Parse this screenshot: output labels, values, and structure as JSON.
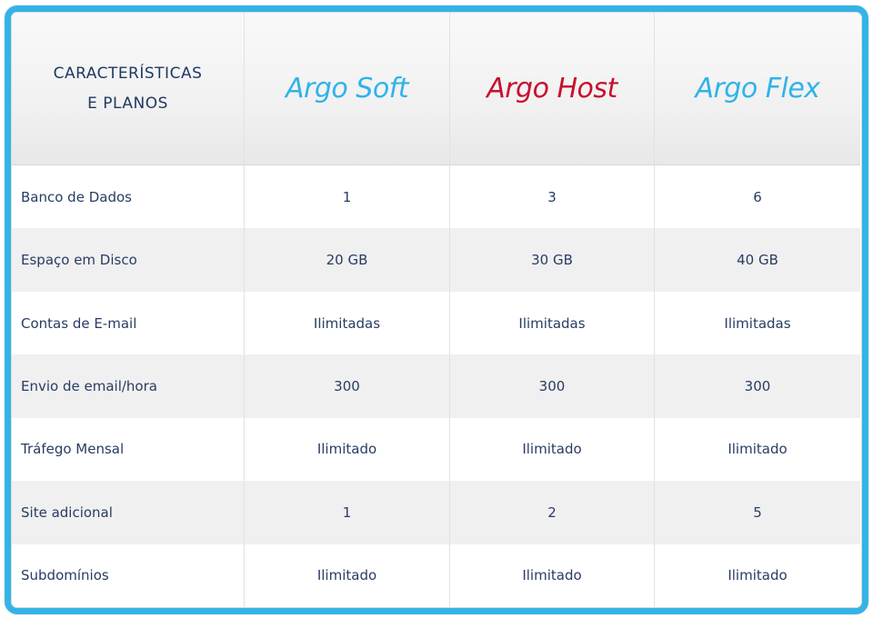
{
  "header": {
    "title_line1": "CARACTERÍSTICAS",
    "title_line2": "E PLANOS",
    "plans": [
      {
        "name": "Argo Soft",
        "color": "#2fb3e8"
      },
      {
        "name": "Argo Host",
        "color": "#c8102e"
      },
      {
        "name": "Argo Flex",
        "color": "#2fb3e8"
      }
    ]
  },
  "rows": [
    {
      "feature": "Banco de Dados",
      "values": [
        "1",
        "3",
        "6"
      ]
    },
    {
      "feature": "Espaço em Disco",
      "values": [
        "20 GB",
        "30 GB",
        "40 GB"
      ]
    },
    {
      "feature": "Contas de E-mail",
      "values": [
        "Ilimitadas",
        "Ilimitadas",
        "Ilimitadas"
      ]
    },
    {
      "feature": "Envio de email/hora",
      "values": [
        "300",
        "300",
        "300"
      ]
    },
    {
      "feature": "Tráfego Mensal",
      "values": [
        "Ilimitado",
        "Ilimitado",
        "Ilimitado"
      ]
    },
    {
      "feature": "Site adicional",
      "values": [
        "1",
        "2",
        "5"
      ]
    },
    {
      "feature": "Subdomínios",
      "values": [
        "Ilimitado",
        "Ilimitado",
        "Ilimitado"
      ]
    }
  ],
  "colors": {
    "frame_border": "#35b3e6",
    "text": "#283c63",
    "stripe": "#f0f0f0"
  }
}
